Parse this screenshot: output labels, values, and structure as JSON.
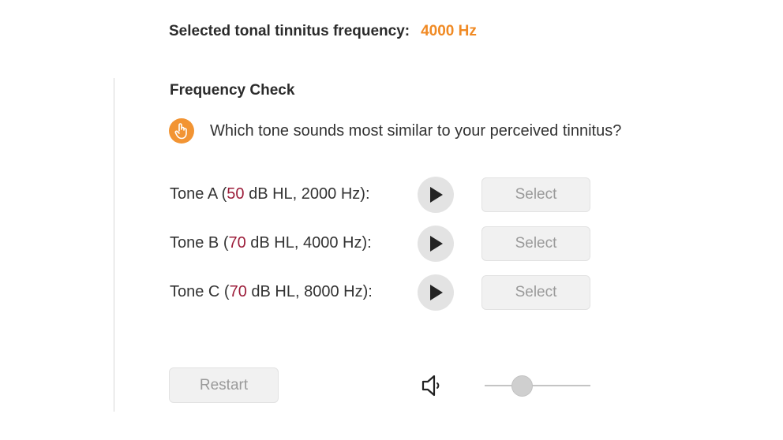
{
  "header": {
    "selected_label": "Selected tonal tinnitus frequency:",
    "selected_value": "4000 Hz"
  },
  "section": {
    "title": "Frequency Check",
    "question_icon": "hand-pointer-icon",
    "question": "Which tone sounds most similar to your perceived tinnitus?"
  },
  "tones": [
    {
      "prefix": "Tone A (",
      "level": "50",
      "suffix": " dB HL, 2000 Hz):",
      "select_label": "Select"
    },
    {
      "prefix": "Tone B (",
      "level": "70",
      "suffix": " dB HL, 4000 Hz):",
      "select_label": "Select"
    },
    {
      "prefix": "Tone C (",
      "level": "70",
      "suffix": " dB HL, 8000 Hz):",
      "select_label": "Select"
    }
  ],
  "controls": {
    "restart_label": "Restart",
    "speaker_icon": "speaker-icon",
    "volume_fraction": 0.35
  },
  "colors": {
    "accent": "#f08a24",
    "level": "#9c1d3a",
    "disabled_text": "#9a9a9a"
  }
}
